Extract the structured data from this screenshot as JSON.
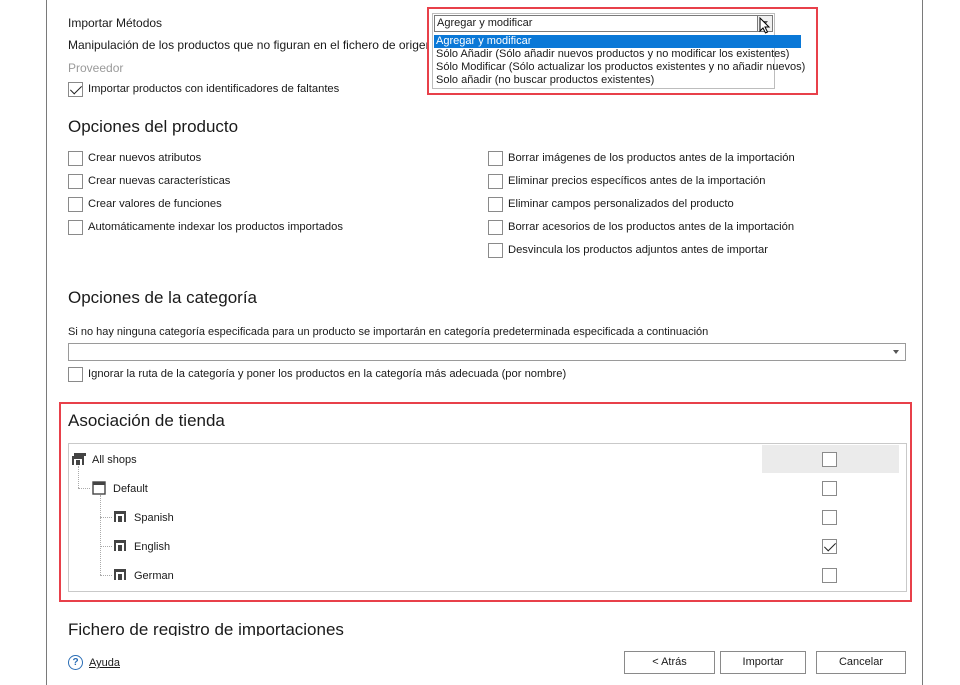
{
  "import": {
    "methods_label": "Importar Métodos",
    "missing_label": "Manipulación de los productos que no figuran en el fichero de origen",
    "supplier_label": "Proveedor",
    "import_missing_ids": "Importar productos con identificadores de faltantes",
    "method_value": "Agregar y modificar",
    "method_options": [
      "Agregar y modificar",
      "Sólo Añadir (Sólo añadir nuevos productos y no modificar los existentes)",
      "Sólo Modificar (Sólo actualizar los productos existentes y no añadir nuevos)",
      "Solo añadir (no buscar productos existentes)"
    ]
  },
  "product_options": {
    "title": "Opciones del producto",
    "left": [
      "Crear nuevos atributos",
      "Crear nuevas características",
      "Crear valores de funciones",
      "Automáticamente indexar los productos importados"
    ],
    "right": [
      "Borrar imágenes de los productos antes de la importación",
      "Eliminar precios específicos antes de la importación",
      "Eliminar campos personalizados del producto",
      "Borrar acesorios de los productos antes de la importación",
      "Desvincula los productos adjuntos antes de importar"
    ]
  },
  "category_options": {
    "title": "Opciones de la categoría",
    "description": "Si no hay ninguna categoría especificada para un producto se importarán en categoría predeterminada especificada a continuación",
    "selected": "",
    "ignore_path": "Ignorar la ruta de la categoría y poner los productos en la categoría más adecuada (por nombre)"
  },
  "store_association": {
    "title": "Asociación de tienda",
    "nodes": [
      {
        "label": "All shops",
        "checked": false
      },
      {
        "label": "Default",
        "checked": false
      },
      {
        "label": "Spanish",
        "checked": false
      },
      {
        "label": "English",
        "checked": true
      },
      {
        "label": "German",
        "checked": false
      }
    ]
  },
  "log": {
    "title": "Fichero de registro de importaciones"
  },
  "footer": {
    "help": "Ayuda",
    "back": "< Atrás",
    "import": "Importar",
    "cancel": "Cancelar"
  },
  "colors": {
    "highlight": "#e8404a",
    "selection": "#0a78d7"
  }
}
